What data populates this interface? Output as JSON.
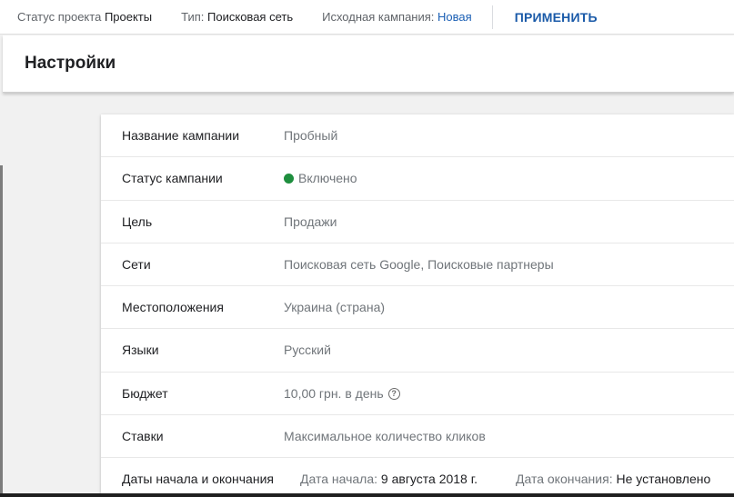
{
  "topbar": {
    "project_status_label": "Статус проекта",
    "project_status_value": "Проекты",
    "type_label": "Тип:",
    "type_value": "Поисковая сеть",
    "source_label": "Исходная кампания:",
    "source_value": "Новая",
    "apply_label": "ПРИМЕНИТЬ"
  },
  "header": {
    "title": "Настройки"
  },
  "settings": {
    "rows": [
      {
        "key": "Название кампании",
        "value": "Пробный"
      },
      {
        "key": "Статус кампании",
        "value": "Включено"
      },
      {
        "key": "Цель",
        "value": "Продажи"
      },
      {
        "key": "Сети",
        "value": "Поисковая сеть Google, Поисковые партнеры"
      },
      {
        "key": "Местоположения",
        "value": "Украина (страна)"
      },
      {
        "key": "Языки",
        "value": "Русский"
      },
      {
        "key": "Бюджет",
        "value": "10,00 грн. в день"
      },
      {
        "key": "Ставки",
        "value": "Максимальное количество кликов"
      }
    ],
    "dates": {
      "key": "Даты начала и окончания",
      "start_label": "Дата начала:",
      "start_value": "9 августа 2018 г.",
      "end_label": "Дата окончания:",
      "end_value": "Не установлено"
    }
  },
  "colors": {
    "status_enabled": "#1e8e3e",
    "link": "#1a5fb4",
    "apply": "#1a5aa8"
  },
  "icons": {
    "status": "status-dot-icon",
    "help": "help-circle-icon"
  }
}
